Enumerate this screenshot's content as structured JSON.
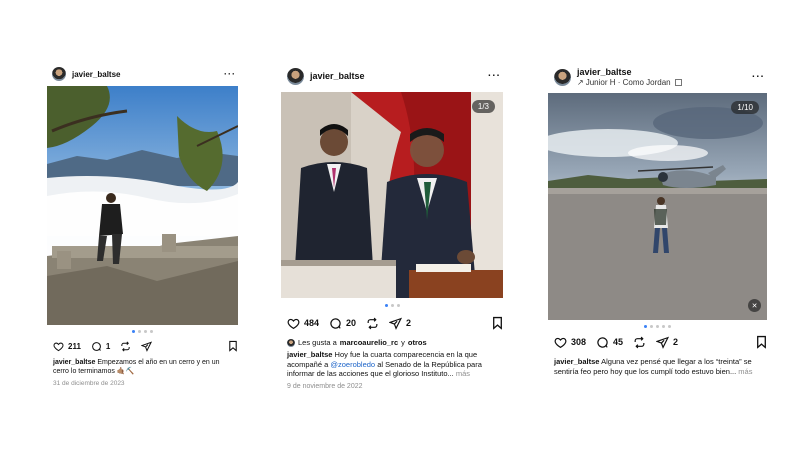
{
  "posts": [
    {
      "username": "javier_baltse",
      "likes": "211",
      "comments": "1",
      "caption_user": "javier_baltse",
      "caption_text": "Empezamos el año en un cerro y en un cerro lo terminamos 🤙🏽⛏️",
      "date": "31 de diciembre de 2023"
    },
    {
      "username": "javier_baltse",
      "counter": "1/3",
      "likes": "484",
      "comments": "20",
      "shares": "2",
      "liked_by_prefix": "Les gusta a",
      "liked_by_user": "marcoaurelio_rc",
      "liked_by_suffix": "y",
      "liked_by_others": "otros",
      "caption_user": "javier_baltse",
      "caption_text_1": "Hoy fue la cuarta comparecencia en la que acompañé a",
      "caption_mention": "@zoerobledo",
      "caption_text_2": "al Senado de la República para informar de las acciones que el glorioso Instituto...",
      "more": "más",
      "date": "9 de noviembre de 2022"
    },
    {
      "username": "javier_baltse",
      "audio": "Junior H · Como Jordan",
      "counter": "1/10",
      "likes": "308",
      "comments": "45",
      "shares": "2",
      "caption_user": "javier_baltse",
      "caption_text": "Alguna vez pensé que llegar a los “treinta” se sentiría feo pero hoy que los cumplí todo estuvo bien...",
      "more": "más"
    }
  ],
  "icons": {
    "heart": "heart-icon",
    "comment": "comment-icon",
    "repost": "repost-icon",
    "share": "share-icon",
    "bookmark": "bookmark-icon"
  }
}
